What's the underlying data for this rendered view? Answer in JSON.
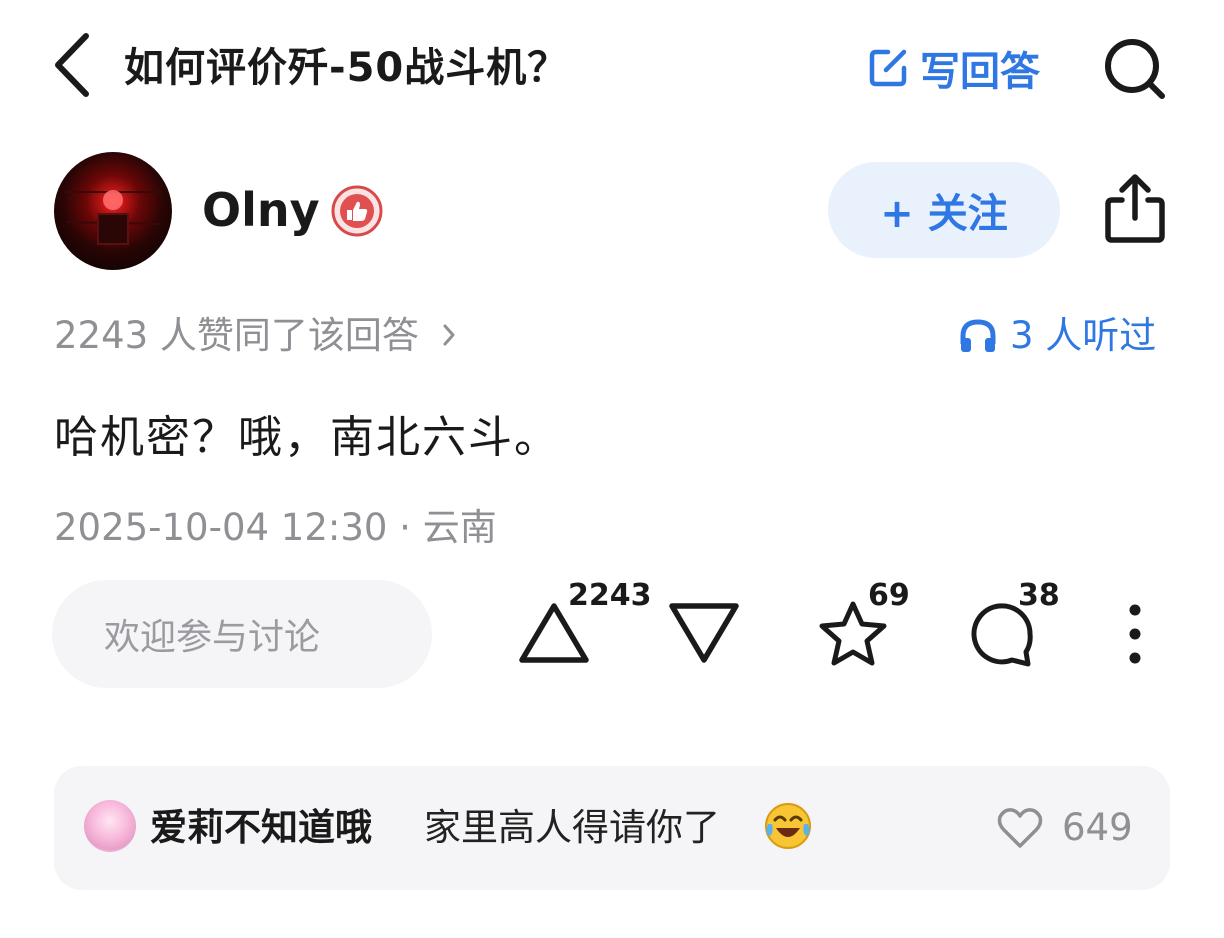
{
  "header": {
    "title": "如何评价歼-50战斗机？",
    "write_answer_label": "写回答"
  },
  "author": {
    "name": "Olny",
    "follow_label": "+ 关注"
  },
  "stats": {
    "upvote_text": "2243 人赞同了该回答",
    "listen_text": "3 人听过"
  },
  "answer": {
    "content": "哈机密？哦，南北六斗。",
    "meta": "2025-10-04 12:30 · 云南"
  },
  "actions": {
    "comment_placeholder": "欢迎参与讨论",
    "upvote_count": "2243",
    "favorite_count": "69",
    "comment_count": "38"
  },
  "top_comment": {
    "user": "爱莉不知道哦",
    "text": "家里高人得请你了",
    "likes": "649"
  },
  "colors": {
    "accent": "#2f77e3",
    "muted": "#8f8f94",
    "badge": "#e05050",
    "follow_bg": "#e9f1fd",
    "card_bg": "#f5f5f7"
  },
  "icons": [
    "back-arrow-icon",
    "edit-icon",
    "search-icon",
    "thumbs-up-badge-icon",
    "share-icon",
    "chevron-right-icon",
    "headphones-icon",
    "upvote-triangle-icon",
    "downvote-triangle-icon",
    "star-icon",
    "comment-bubble-icon",
    "more-vertical-icon",
    "heart-icon",
    "laughing-crying-emoji-icon"
  ]
}
